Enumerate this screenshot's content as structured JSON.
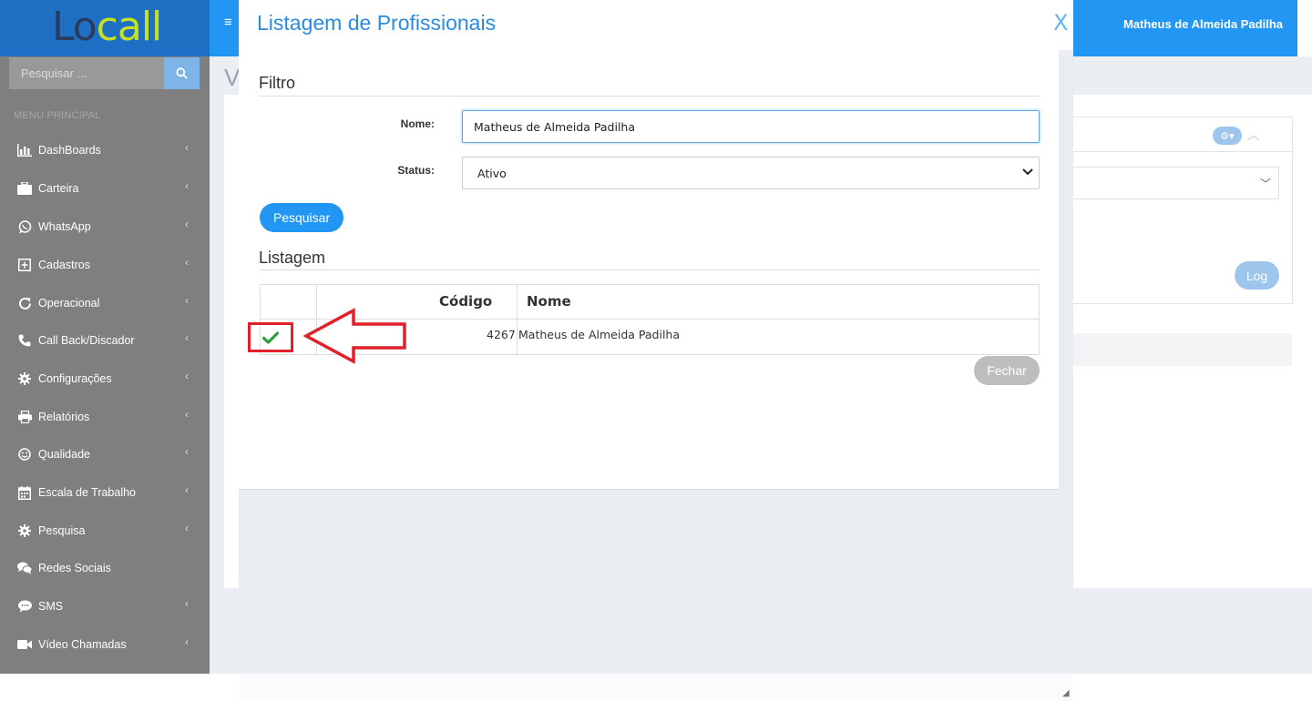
{
  "app": {
    "logo_text": "Locall",
    "user_name": "Matheus de Almeida Padilha"
  },
  "sidebar": {
    "search_placeholder": "Pesquisar ...",
    "menu_header": "MENU PRINCIPAL",
    "items": [
      {
        "label": "DashBoards",
        "icon": "bar-chart-icon",
        "has_submenu": true
      },
      {
        "label": "Carteira",
        "icon": "briefcase-icon",
        "has_submenu": true
      },
      {
        "label": "WhatsApp",
        "icon": "whatsapp-icon",
        "has_submenu": true
      },
      {
        "label": "Cadastros",
        "icon": "plus-square-icon",
        "has_submenu": true
      },
      {
        "label": "Operacional",
        "icon": "refresh-icon",
        "has_submenu": true
      },
      {
        "label": "Call Back/Discador",
        "icon": "phone-icon",
        "has_submenu": true
      },
      {
        "label": "Configurações",
        "icon": "gear-icon",
        "has_submenu": true
      },
      {
        "label": "Relatórios",
        "icon": "printer-icon",
        "has_submenu": true
      },
      {
        "label": "Qualidade",
        "icon": "smile-icon",
        "has_submenu": true
      },
      {
        "label": "Escala de Trabalho",
        "icon": "calendar-icon",
        "has_submenu": true
      },
      {
        "label": "Pesquisa",
        "icon": "gear-icon",
        "has_submenu": true
      },
      {
        "label": "Redes Sociais",
        "icon": "comments-icon",
        "has_submenu": false
      },
      {
        "label": "SMS",
        "icon": "chat-icon",
        "has_submenu": true
      },
      {
        "label": "Vídeo Chamadas",
        "icon": "video-camera-icon",
        "has_submenu": true
      }
    ]
  },
  "background": {
    "page_title_fragment": "V",
    "log_button": "Log"
  },
  "modal": {
    "title": "Listagem de Profissionais",
    "close_label": "X",
    "filter_section": "Filtro",
    "name_label": "Nome:",
    "name_value": "Matheus de Almeida Padilha",
    "status_label": "Status:",
    "status_value": "Ativo",
    "search_button": "Pesquisar",
    "list_section": "Listagem",
    "table": {
      "columns": [
        "",
        "Código",
        "Nome"
      ],
      "rows": [
        {
          "code": "4267",
          "name": "Matheus de Almeida Padilha",
          "selected": true
        }
      ]
    },
    "close_button": "Fechar"
  },
  "colors": {
    "accent": "#2196f3",
    "logo_bg": "#1f70c4",
    "sidebar_bg": "#7f7f7f",
    "annotation_red": "#e0202a",
    "check_green": "#2e9e3e"
  }
}
